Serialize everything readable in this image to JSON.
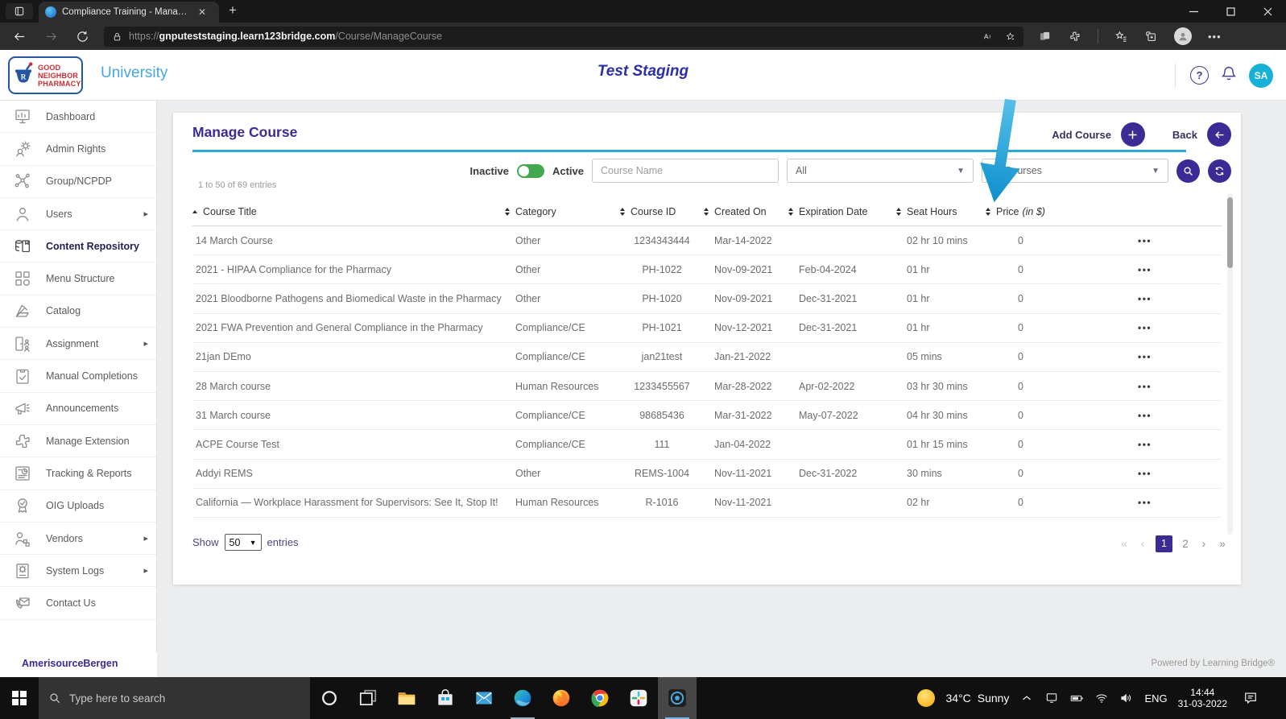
{
  "colors": {
    "accent": "#3b2b94",
    "teal": "#27a9db",
    "toggle-green": "#43a94e",
    "avatar-cyan": "#17b1d8",
    "arrow-blue": "#149bd5"
  },
  "browser": {
    "tab_title": "Compliance Training - Manage C",
    "url_scheme": "https://",
    "url_domain": "gnputeststaging.learn123bridge.com",
    "url_path": "/Course/ManageCourse"
  },
  "header": {
    "logo": {
      "word1": "GOOD",
      "word2": "NEIGHBOR",
      "word3": "PHARMACY",
      "rx": "R"
    },
    "brand": "University",
    "environment": "Test Staging",
    "avatar_initials": "SA"
  },
  "sidebar": {
    "items": [
      {
        "label": "Dashboard",
        "icon": "dashboard"
      },
      {
        "label": "Admin Rights",
        "icon": "admin-rights"
      },
      {
        "label": "Group/NCPDP",
        "icon": "group-ncpdp"
      },
      {
        "label": "Users",
        "icon": "users",
        "submenu": true
      },
      {
        "label": "Content Repository",
        "icon": "content-repository",
        "active": true
      },
      {
        "label": "Menu Structure",
        "icon": "menu-structure"
      },
      {
        "label": "Catalog",
        "icon": "catalog"
      },
      {
        "label": "Assignment",
        "icon": "assignment",
        "submenu": true
      },
      {
        "label": "Manual Completions",
        "icon": "manual-completions"
      },
      {
        "label": "Announcements",
        "icon": "announcements"
      },
      {
        "label": "Manage Extension",
        "icon": "manage-extension"
      },
      {
        "label": "Tracking & Reports",
        "icon": "tracking-reports"
      },
      {
        "label": "OIG Uploads",
        "icon": "oig-uploads"
      },
      {
        "label": "Vendors",
        "icon": "vendors",
        "submenu": true
      },
      {
        "label": "System Logs",
        "icon": "system-logs",
        "submenu": true
      },
      {
        "label": "Contact Us",
        "icon": "contact-us"
      }
    ]
  },
  "page": {
    "title": "Manage Course",
    "add_course_label": "Add Course",
    "back_label": "Back",
    "inactive_label": "Inactive",
    "active_label": "Active",
    "course_name_placeholder": "Course Name",
    "category_filter_value": "All",
    "course_filter_value": "All Courses",
    "entries_info": "1 to 50 of 69 entries",
    "show_label": "Show",
    "page_size": "50",
    "entries_label": "entries",
    "pagination": [
      {
        "label": "«",
        "state": "disabled"
      },
      {
        "label": "‹",
        "state": "disabled"
      },
      {
        "label": "1",
        "state": "active"
      },
      {
        "label": "2",
        "state": "normal"
      },
      {
        "label": "›",
        "state": "normal"
      },
      {
        "label": "»",
        "state": "normal"
      }
    ]
  },
  "table": {
    "columns": [
      {
        "label": "Course Title",
        "sort": "asc"
      },
      {
        "label": "Category",
        "sort": "both"
      },
      {
        "label": "Course ID",
        "sort": "both"
      },
      {
        "label": "Created On",
        "sort": "both"
      },
      {
        "label": "Expiration Date",
        "sort": "both"
      },
      {
        "label": "Seat Hours",
        "sort": "both"
      },
      {
        "label": "Price",
        "suffix": "(in $)",
        "sort": "both"
      },
      {
        "label": "",
        "sort": "none"
      }
    ],
    "rows": [
      {
        "title": "14 March Course",
        "category": "Other",
        "course_id": "1234343444",
        "created_on": "Mar-14-2022",
        "expiration_date": "",
        "seat_hours": "02 hr 10 mins",
        "price": "0"
      },
      {
        "title": "2021 - HIPAA Compliance for the Pharmacy",
        "category": "Other",
        "course_id": "PH-1022",
        "created_on": "Nov-09-2021",
        "expiration_date": "Feb-04-2024",
        "seat_hours": "01 hr",
        "price": "0"
      },
      {
        "title": "2021 Bloodborne Pathogens and Biomedical Waste in the Pharmacy",
        "category": "Other",
        "course_id": "PH-1020",
        "created_on": "Nov-09-2021",
        "expiration_date": "Dec-31-2021",
        "seat_hours": "01 hr",
        "price": "0"
      },
      {
        "title": "2021 FWA Prevention and General Compliance in the Pharmacy",
        "category": "Compliance/CE",
        "course_id": "PH-1021",
        "created_on": "Nov-12-2021",
        "expiration_date": "Dec-31-2021",
        "seat_hours": "01 hr",
        "price": "0"
      },
      {
        "title": "21jan DEmo",
        "category": "Compliance/CE",
        "course_id": "jan21test",
        "created_on": "Jan-21-2022",
        "expiration_date": "",
        "seat_hours": "05 mins",
        "price": "0"
      },
      {
        "title": "28 March course",
        "category": "Human Resources",
        "course_id": "1233455567",
        "created_on": "Mar-28-2022",
        "expiration_date": "Apr-02-2022",
        "seat_hours": "03 hr 30 mins",
        "price": "0"
      },
      {
        "title": "31 March course",
        "category": "Compliance/CE",
        "course_id": "98685436",
        "created_on": "Mar-31-2022",
        "expiration_date": "May-07-2022",
        "seat_hours": "04 hr 30 mins",
        "price": "0"
      },
      {
        "title": "ACPE Course Test",
        "category": "Compliance/CE",
        "course_id": "111",
        "created_on": "Jan-04-2022",
        "expiration_date": "",
        "seat_hours": "01 hr 15 mins",
        "price": "0"
      },
      {
        "title": "Addyi REMS",
        "category": "Other",
        "course_id": "REMS-1004",
        "created_on": "Nov-11-2021",
        "expiration_date": "Dec-31-2022",
        "seat_hours": "30 mins",
        "price": "0"
      },
      {
        "title": "California — Workplace Harassment for Supervisors: See It, Stop It!",
        "category": "Human Resources",
        "course_id": "R-1016",
        "created_on": "Nov-11-2021",
        "expiration_date": "",
        "seat_hours": "02 hr",
        "price": "0"
      }
    ]
  },
  "footer": {
    "company": "AmerisourceBergen",
    "powered_by": "Powered by Learning Bridge®"
  },
  "taskbar": {
    "search_placeholder": "Type here to search",
    "apps": [
      {
        "icon": "cortana"
      },
      {
        "icon": "task-view"
      },
      {
        "icon": "file-explorer"
      },
      {
        "icon": "microsoft-store"
      },
      {
        "icon": "mail"
      },
      {
        "icon": "edge",
        "underline": true
      },
      {
        "icon": "firefox"
      },
      {
        "icon": "chrome"
      },
      {
        "icon": "slack"
      },
      {
        "icon": "screen-recorder",
        "active": true
      }
    ],
    "weather_temp": "34°C",
    "weather_desc": "Sunny",
    "tray_icons": [
      "chevron-up",
      "phone-link",
      "battery",
      "wifi",
      "volume"
    ],
    "language": "ENG",
    "time": "14:44",
    "date": "31-03-2022"
  }
}
